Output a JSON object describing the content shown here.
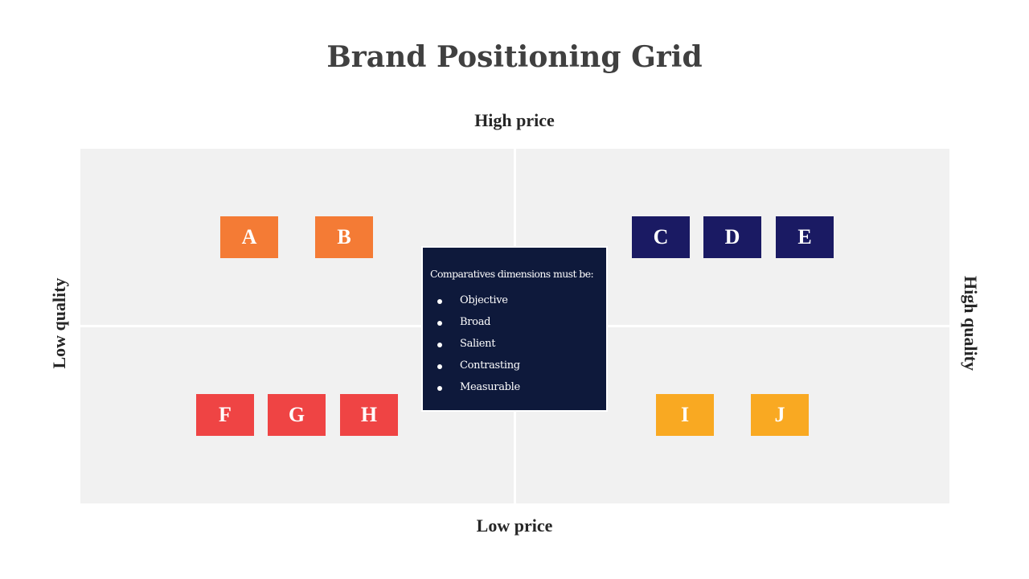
{
  "title": "Brand Positioning Grid",
  "axes": {
    "top": "High price",
    "bottom": "Low price",
    "left": "Low quality",
    "right": "High quality"
  },
  "colors": {
    "quadrant_bg": "#f1f1f1",
    "orange": "#f47b35",
    "navy": "#1a1a63",
    "red": "#ef4444",
    "yellow": "#f9a922",
    "info_bg": "#0e193b"
  },
  "quadrants": {
    "top_left": {
      "brands": [
        "A",
        "B"
      ]
    },
    "top_right": {
      "brands": [
        "C",
        "D",
        "E"
      ]
    },
    "bottom_left": {
      "brands": [
        "F",
        "G",
        "H"
      ]
    },
    "bottom_right": {
      "brands": [
        "I",
        "J"
      ]
    }
  },
  "info_box": {
    "heading": "Comparatives dimensions must be:",
    "items": [
      "Objective",
      "Broad",
      "Salient",
      "Contrasting",
      "Measurable"
    ]
  }
}
